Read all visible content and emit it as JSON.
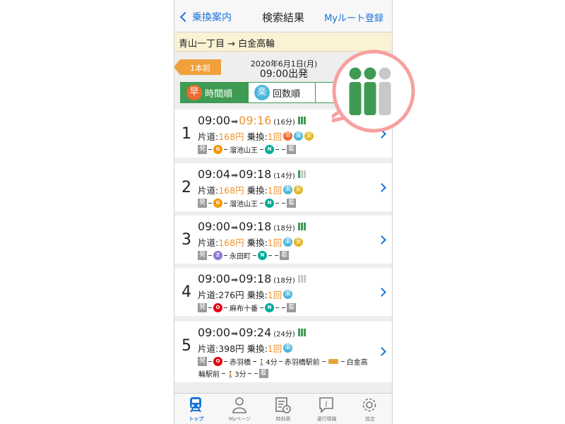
{
  "nav": {
    "back_label": "乗換案内",
    "title": "検索結果",
    "myroute_label": "Myルート登録"
  },
  "route": "青山一丁目 → 白金高輪",
  "header": {
    "prev_label": "1本前",
    "date": "2020年6月1日(月)",
    "time": "09:00出発"
  },
  "sort_tabs": [
    {
      "badge": "早",
      "label": "時間順",
      "active": true
    },
    {
      "badge": "楽",
      "label": "回数順",
      "active": false
    }
  ],
  "results": [
    {
      "num": "1",
      "dep": "09:00",
      "arr": "09:16",
      "arr_highlight": true,
      "duration": "(16分)",
      "fare_label": "片道:",
      "fare": "168円",
      "fare_highlight": true,
      "transfer_label": "乗換:",
      "transfers": "1回",
      "badges": [
        "早",
        "楽",
        "安"
      ],
      "crowding": 3,
      "path": [
        {
          "type": "box",
          "text": "発"
        },
        {
          "type": "line",
          "text": "G",
          "color": "#f39700"
        },
        {
          "type": "name",
          "text": "溜池山王"
        },
        {
          "type": "line",
          "text": "N",
          "color": "#00ac9b"
        },
        {
          "type": "box",
          "text": "着"
        }
      ]
    },
    {
      "num": "2",
      "dep": "09:04",
      "arr": "09:18",
      "arr_highlight": false,
      "duration": "(14分)",
      "fare_label": "片道:",
      "fare": "168円",
      "fare_highlight": true,
      "transfer_label": "乗換:",
      "transfers": "1回",
      "badges": [
        "楽",
        "安"
      ],
      "crowding": 1,
      "path": [
        {
          "type": "box",
          "text": "発"
        },
        {
          "type": "line",
          "text": "G",
          "color": "#f39700"
        },
        {
          "type": "name",
          "text": "溜池山王"
        },
        {
          "type": "line",
          "text": "N",
          "color": "#00ac9b"
        },
        {
          "type": "box",
          "text": "着"
        }
      ]
    },
    {
      "num": "3",
      "dep": "09:00",
      "arr": "09:18",
      "arr_highlight": false,
      "duration": "(18分)",
      "fare_label": "片道:",
      "fare": "168円",
      "fare_highlight": true,
      "transfer_label": "乗換:",
      "transfers": "1回",
      "badges": [
        "楽",
        "安"
      ],
      "crowding": 3,
      "path": [
        {
          "type": "box",
          "text": "発"
        },
        {
          "type": "line",
          "text": "Z",
          "color": "#8f76d6"
        },
        {
          "type": "name",
          "text": "永田町"
        },
        {
          "type": "line",
          "text": "N",
          "color": "#00ac9b"
        },
        {
          "type": "box",
          "text": "着"
        }
      ]
    },
    {
      "num": "4",
      "dep": "09:00",
      "arr": "09:18",
      "arr_highlight": false,
      "duration": "(18分)",
      "fare_label": "片道:",
      "fare": "276円",
      "fare_highlight": false,
      "transfer_label": "乗換:",
      "transfers": "1回",
      "badges": [
        "楽"
      ],
      "crowding": 0,
      "path": [
        {
          "type": "box",
          "text": "発"
        },
        {
          "type": "line",
          "text": "O",
          "color": "#e60012"
        },
        {
          "type": "name",
          "text": "麻布十番"
        },
        {
          "type": "line",
          "text": "N",
          "color": "#00ac9b"
        },
        {
          "type": "box",
          "text": "着"
        }
      ]
    },
    {
      "num": "5",
      "dep": "09:00",
      "arr": "09:24",
      "arr_highlight": false,
      "duration": "(24分)",
      "fare_label": "片道:",
      "fare": "398円",
      "fare_highlight": false,
      "transfer_label": "乗換:",
      "transfers": "1回",
      "badges": [
        "楽"
      ],
      "crowding": 3,
      "path": [
        {
          "type": "box",
          "text": "発"
        },
        {
          "type": "line",
          "text": "O",
          "color": "#e60012"
        },
        {
          "type": "name",
          "text": "赤羽橋"
        },
        {
          "type": "walk",
          "text": "4分"
        },
        {
          "type": "name",
          "text": "赤羽橋駅前"
        },
        {
          "type": "bus",
          "text": ""
        },
        {
          "type": "name",
          "text": "白金高"
        }
      ],
      "path2": [
        {
          "type": "name",
          "text": "輪駅前"
        },
        {
          "type": "walk",
          "text": "3分"
        },
        {
          "type": "box",
          "text": "着"
        }
      ]
    }
  ],
  "tabbar": [
    {
      "label": "トップ",
      "icon": "train-icon",
      "active": true
    },
    {
      "label": "Myページ",
      "icon": "person-icon",
      "active": false
    },
    {
      "label": "時刻表",
      "icon": "timetable-icon",
      "active": false
    },
    {
      "label": "運行情報",
      "icon": "info-icon",
      "active": false
    },
    {
      "label": "設定",
      "icon": "gear-icon",
      "active": false
    }
  ],
  "colors": {
    "accent_blue": "#1a73d9",
    "green": "#3f9b53",
    "orange": "#f0932b",
    "zoom_ring": "#f7a0a0"
  }
}
